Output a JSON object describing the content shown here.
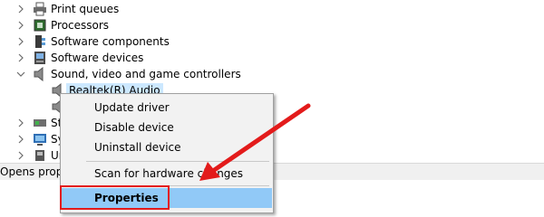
{
  "tree": {
    "items": [
      {
        "label": "Print queues",
        "icon": "printer-icon",
        "state": "collapsed"
      },
      {
        "label": "Processors",
        "icon": "processor-icon",
        "state": "collapsed"
      },
      {
        "label": "Software components",
        "icon": "software-component-icon",
        "state": "collapsed"
      },
      {
        "label": "Software devices",
        "icon": "software-device-icon",
        "state": "collapsed"
      },
      {
        "label": "Sound, video and game controllers",
        "icon": "speaker-icon",
        "state": "expanded"
      }
    ],
    "children": [
      {
        "label": "Realtek(R) Audio",
        "icon": "speaker-icon",
        "selected": true
      },
      {
        "label": "",
        "icon": "speaker-icon"
      }
    ],
    "partial_items": [
      {
        "label": "St",
        "icon": "storage-icon"
      },
      {
        "label": "Sy",
        "icon": "system-icon"
      },
      {
        "label": "Ur",
        "icon": "usb-icon"
      }
    ]
  },
  "context_menu": {
    "items": [
      {
        "label": "Update driver"
      },
      {
        "label": "Disable device"
      },
      {
        "label": "Uninstall device"
      },
      {
        "label": "Scan for hardware changes"
      },
      {
        "label": "Properties",
        "highlighted": true
      }
    ]
  },
  "status_bar": {
    "text": "Opens propert"
  },
  "annotation": {
    "color": "#e31b1b"
  },
  "colors": {
    "highlight": "#91c9f7",
    "selection": "#cce8ff",
    "menu_bg": "#f2f2f2"
  }
}
